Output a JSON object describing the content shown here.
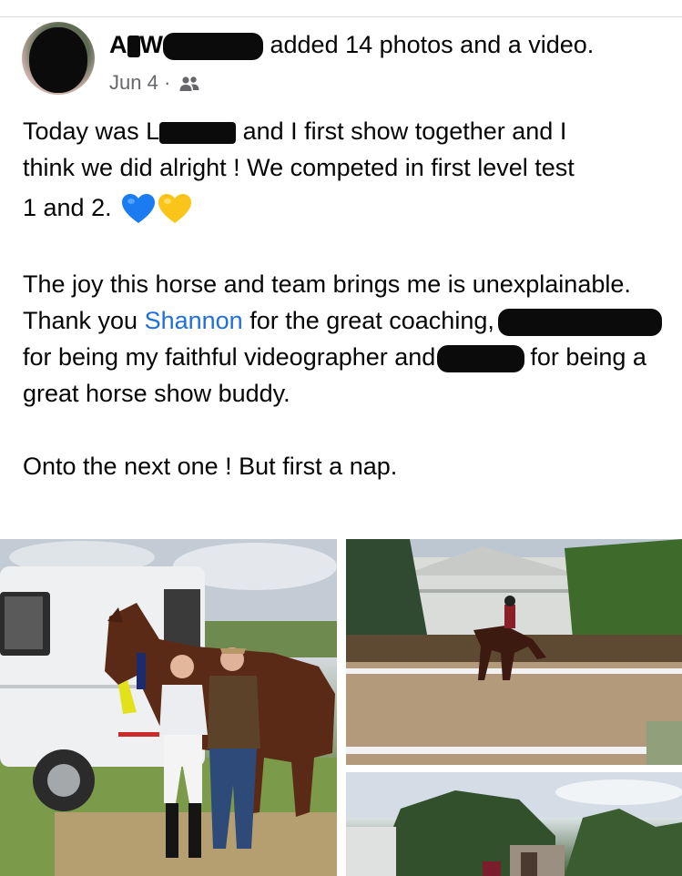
{
  "post": {
    "author_first": "A",
    "author_last_initial": "W",
    "action": "added 14 photos and a video.",
    "date": "Jun 4",
    "separator": "·",
    "audience_icon": "friends-icon",
    "text": {
      "line1_start": "Today was L",
      "line1_end": "and I first show together and I",
      "line2": "think we did alright ! We competed in first level test",
      "line3": "1 and 2.",
      "para2_start": "The joy this horse and team brings me is unexplainable. Thank you ",
      "mention": "Shannon",
      "para2_after_mention": " for the great coaching,",
      "para2_after_redact1": "for being my faithful",
      "para2_videographer": "videographer and",
      "para2_after_redact2": "for being a great horse show buddy.",
      "para3": "Onto the next one ! But first a nap."
    },
    "colors": {
      "link": "#216fdb",
      "meta": "#65676b",
      "heart_blue": "#1a7cf0",
      "heart_yellow": "#f9c51b"
    },
    "photos": [
      "horse-trailer-photo",
      "dressage-arena-photo",
      "barn-photo"
    ]
  }
}
